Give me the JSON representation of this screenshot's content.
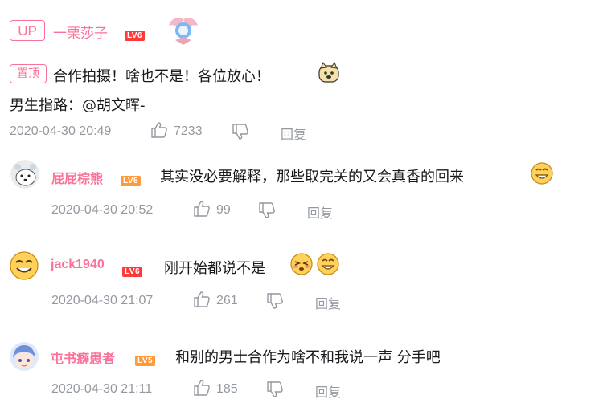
{
  "pinned": {
    "up_badge": "UP",
    "author": "一栗莎子",
    "level": "LV6",
    "pin_label": "置顶",
    "text": "合作拍摄！啥也不是！各位放心！",
    "text2": "男生指路：@胡文晖-",
    "date": "2020-04-30 20:49",
    "likes": "7233",
    "reply_label": "回复"
  },
  "comments": [
    {
      "author": "屁屁棕熊",
      "level": "LV5",
      "text": "其实没必要解释，那些取完关的又会真香的回来",
      "date": "2020-04-30 20:52",
      "likes": "99",
      "reply_label": "回复"
    },
    {
      "author": "jack1940",
      "level": "LV6",
      "text": "刚开始都说不是",
      "date": "2020-04-30 21:07",
      "likes": "261",
      "reply_label": "回复"
    },
    {
      "author": "屯书癖患者",
      "level": "LV5",
      "text": "和别的男士合作为啥不和我说一声 分手吧",
      "date": "2020-04-30 21:11",
      "likes": "185",
      "reply_label": "回复"
    }
  ],
  "colors": {
    "accent": "#fb7299",
    "meta": "#9499a0",
    "lv6": "#ff3a3a",
    "lv5": "#ff9a3a"
  },
  "icons": [
    "up-badge",
    "level-badge",
    "medal-icon",
    "doge-emoji",
    "bear-avatar",
    "smile-avatar",
    "anime-avatar",
    "thumbs-up-icon",
    "thumbs-down-icon",
    "grin-emoji",
    "blush-emoji"
  ]
}
